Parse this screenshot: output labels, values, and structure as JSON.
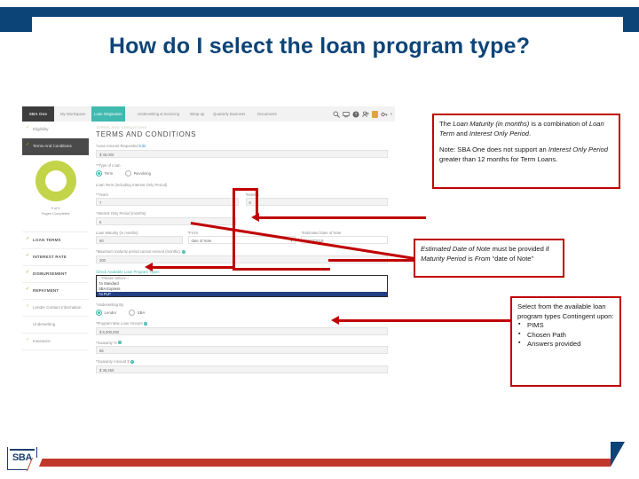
{
  "slide": {
    "title": "How do I select the loan program type?",
    "logo_text": "SBA",
    "accent_navy": "#0d4478",
    "accent_red": "#c0392b",
    "callout_border": "#c00000"
  },
  "app": {
    "brand": "SBA One",
    "nav": [
      {
        "label": "My Workspace",
        "active": false,
        "caret": false
      },
      {
        "label": "Loan Origination",
        "active": true,
        "caret": true
      },
      {
        "label": "Underwriting & Servicing",
        "active": false,
        "caret": true
      },
      {
        "label": "Wrap-up",
        "active": false,
        "caret": false
      },
      {
        "label": "Quarterly Business",
        "active": false,
        "caret": true
      },
      {
        "label": "Documents",
        "active": false,
        "caret": false
      }
    ],
    "nav_icons": [
      "search-icon",
      "cart-icon",
      "help-icon",
      "people-icon",
      "app-square-icon",
      "key-icon",
      "user-caret-icon"
    ],
    "sidebar": {
      "items_top": [
        {
          "label": "Eligibility",
          "check": true,
          "dark": false
        },
        {
          "label": "Terms And Conditions",
          "check": true,
          "dark": true
        }
      ],
      "progress_percent": "100%",
      "progress_count": "9 of 9",
      "progress_label": "Pages Completed",
      "items_bottom": [
        {
          "label": "LOAN TERMS",
          "check": true,
          "strong": true
        },
        {
          "label": "INTEREST RATE",
          "check": true,
          "strong": true
        },
        {
          "label": "DISBURSEMENT",
          "check": true,
          "strong": true
        },
        {
          "label": "REPAYMENT",
          "check": true,
          "strong": true
        },
        {
          "label": "Lender Contact Information",
          "check": true,
          "strong": false
        },
        {
          "label": "Underwriting",
          "check": false,
          "strong": false
        },
        {
          "label": "Insurance",
          "check": true,
          "strong": false
        }
      ]
    },
    "form": {
      "breadcrumb": "TERMS AND CONDITIONS",
      "title": "TERMS AND CONDITIONS",
      "loan_amount_label": "*Loan Amount Requested",
      "loan_amount_edit": "Edit",
      "loan_amount_value": "$ 45,000",
      "type_of_loan_label": "**Type of Loan",
      "type_term": "Term",
      "type_revolving": "Revolving",
      "loan_term_header": "Loan Term (including Interest Only Period)",
      "years_label": "**Years",
      "years_value": "7",
      "months_label": "*Months",
      "months_value": "6",
      "interest_only_label": "*Interest Only Period (months)",
      "interest_only_value": "6",
      "maturity_label": "Loan Maturity  (in months)",
      "maturity_value": "90",
      "from_label": "*From",
      "from_value": "date of Note",
      "est_date_label": "*Estimated Date of Note",
      "est_date_value": "04/23/2018",
      "max_maturity_label": "*Maximum maturity period cannot exceed  (months):",
      "max_maturity_value": "300",
      "program_section_label": "Check Available Loan Program Types",
      "program_options": [
        {
          "label": "---Please Select---",
          "selected": false,
          "placeholder": true
        },
        {
          "label": "7a Standard",
          "selected": false,
          "placeholder": false
        },
        {
          "label": "SBA Express",
          "selected": false,
          "placeholder": false
        },
        {
          "label": "7a PLP",
          "selected": true,
          "placeholder": false
        }
      ],
      "underwriting_by_label": "*Underwriting By",
      "underwriting_lender": "Lender",
      "underwriting_sba": "SBA",
      "program_max_label": "*Program Max Loan Amount",
      "program_max_value": "$ 5,000,000",
      "guaranty_pct_label": "*Guaranty %",
      "guaranty_pct_value": "85",
      "guaranty_amt_label": "*Guaranty Amount $",
      "guaranty_amt_value": "$ 38,250"
    }
  },
  "callouts": {
    "one": {
      "p1_a": "The ",
      "p1_i1": "Loan Maturity (in months)",
      "p1_b": " is a combination of ",
      "p1_i2": "Loan Term",
      "p1_c": " and ",
      "p1_i3": "Interest Only Period",
      "p1_d": ".",
      "p2_a": "Note: SBA One does not support an ",
      "p2_i1": "Interest Only Period",
      "p2_b": " greater than 12 months for Term Loans."
    },
    "two": {
      "i1": "Estimated Date of Note",
      "a": " must be provided if ",
      "i2": "Maturity Period",
      "b": " is ",
      "i3": "From",
      "c": " “date of Note”"
    },
    "three": {
      "intro": "Select from the available loan program types  Contingent upon:",
      "bullets": [
        "PIMS",
        "Chosen Path",
        "Answers provided"
      ]
    }
  }
}
